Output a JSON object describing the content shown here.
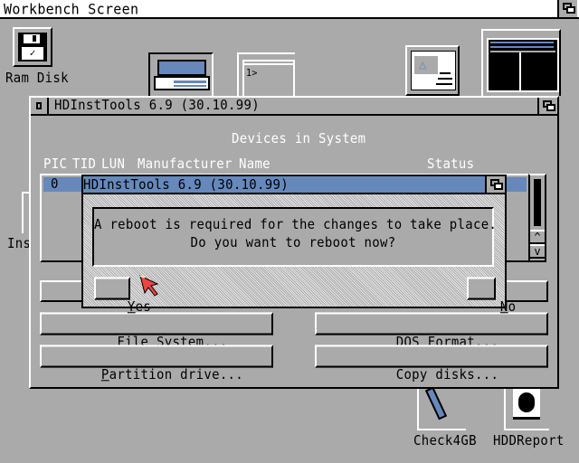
{
  "screen": {
    "title": "Workbench Screen"
  },
  "desktop_icons": [
    {
      "name": "ram-disk",
      "label": "Ram Disk"
    },
    {
      "name": "installer-partial",
      "label": "Ins"
    },
    {
      "name": "check4gb",
      "label": "Check4GB"
    },
    {
      "name": "hddreport",
      "label": "HDDReport"
    }
  ],
  "main_window": {
    "title": "HDInstTools 6.9 (30.10.99)",
    "section_title": "Devices in System",
    "columns": [
      "PIC",
      "TID",
      "LUN",
      "Manufacturer",
      "Name",
      "Status"
    ],
    "rows": [
      {
        "pic": "0",
        "tid": "",
        "lun": "",
        "manufacturer": "",
        "name": "",
        "status": ""
      }
    ],
    "buttons": {
      "file_system": {
        "prefix": "",
        "hotkey": "F",
        "rest": "ile System..."
      },
      "dos_format": {
        "prefix": "",
        "hotkey": "D",
        "rest": "OS Format..."
      },
      "partition_drive": {
        "prefix": "",
        "hotkey": "P",
        "rest": "artition drive..."
      },
      "copy_disks": {
        "label": "Copy disks..."
      }
    }
  },
  "requester": {
    "title": "HDInstTools 6.9 (30.10.99)",
    "message_line1": "A reboot is required for the changes to take place.",
    "message_line2": "Do you want to reboot now?",
    "yes": {
      "hotkey": "Y",
      "rest": "es"
    },
    "no": {
      "hotkey": "N",
      "rest": "o"
    }
  },
  "colors": {
    "background": "#aaaaaa",
    "accent": "#6688bb",
    "pointer": "#ee4444"
  }
}
